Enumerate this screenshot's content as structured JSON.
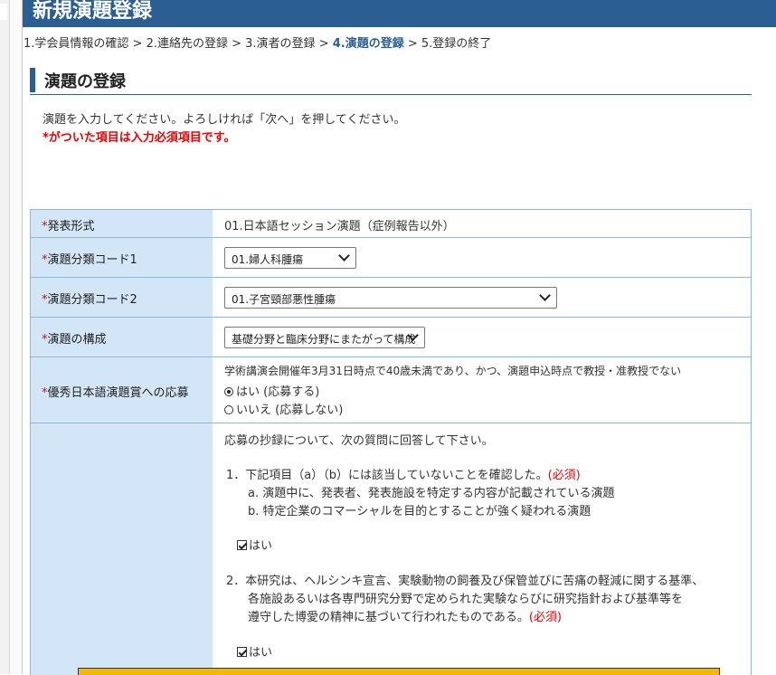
{
  "page_title": "新規演題登録",
  "steps": [
    {
      "label": "1.学会員情報の確認",
      "sep": " > "
    },
    {
      "label": "2.連絡先の登録",
      "sep": " > "
    },
    {
      "label": "3.演者の登録",
      "sep": " > "
    },
    {
      "label": "4.演題の登録",
      "sep": " > "
    },
    {
      "label": "5.登録の終了",
      "sep": ""
    }
  ],
  "section_title": "演題の登録",
  "intro_text": "演題を入力してください。よろしければ「次へ」を押してください。",
  "required_note": "*がついた項目は入力必須項目です。",
  "form": {
    "format": {
      "label": "発表形式",
      "value": "01.日本語セッション演題（症例報告以外）"
    },
    "category1": {
      "label": "演題分類コード1",
      "value": "01.婦人科腫瘍"
    },
    "category2": {
      "label": "演題分類コード2",
      "value": "01.子宮頸部悪性腫瘍"
    },
    "composition": {
      "label": "演題の構成",
      "value": "基礎分野と臨床分野にまたがって構成"
    },
    "award": {
      "label": "優秀日本語演題賞への応募",
      "note": "学術講演会開催年3月31日時点で40歳未満であり、かつ、演題申込時点で教授・准教授でない",
      "option_yes": "はい (応募する)",
      "option_no": "いいえ (応募しない)"
    },
    "questions": {
      "intro": "応募の抄録について、次の質問に回答して下さい。",
      "q1": "1．下記項目（a）（b）には該当していないことを確認した。",
      "q1_req": "(必須)",
      "q1_a": "a. 演題中に、発表者、発表施設を特定する内容が記載されている演題",
      "q1_b": "b. 特定企業のコマーシャルを目的とすることが強く疑われる演題",
      "q1_check": "はい",
      "q2_line1": "2．本研究は、ヘルシンキ宣言、実験動物の飼養及び保管並びに苦痛の軽減に関する基準、",
      "q2_line2": "各施設あるいは各専門研究分野で定められた実験ならびに研究指針および基準等を",
      "q2_line3": "遵守した博愛の精神に基づいて行われたものである。",
      "q2_req": "(必須)",
      "q2_check": "はい"
    }
  },
  "required_mark": "*",
  "colors": {
    "header": "#2b5f94",
    "label_bg": "#d3e6f7",
    "required": "#e00000",
    "accent_bar": "#f5b800"
  }
}
